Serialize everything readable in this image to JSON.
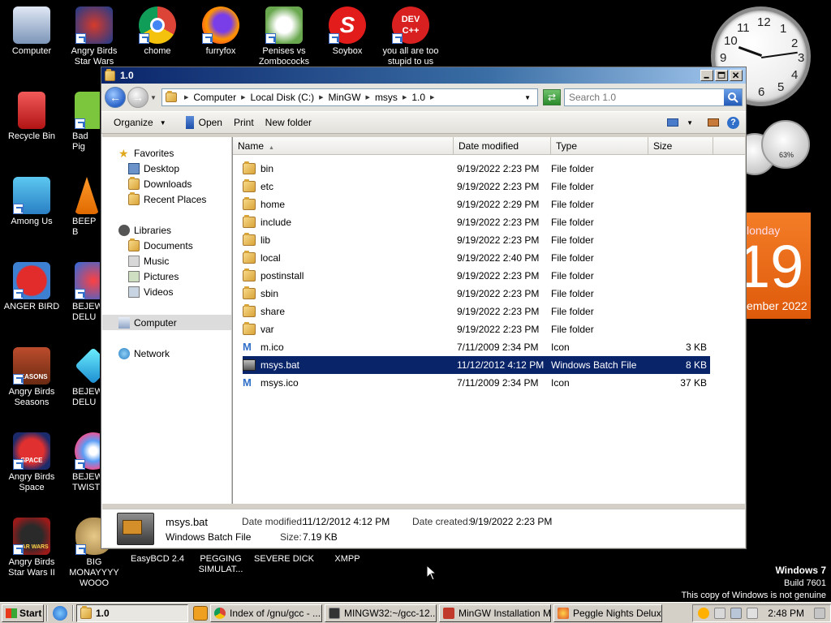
{
  "desktop": {
    "icons": [
      {
        "label": "Computer"
      },
      {
        "label": "Angry Birds Star Wars"
      },
      {
        "label": "chome"
      },
      {
        "label": "furryfox"
      },
      {
        "label": "Penises vs Zombococks"
      },
      {
        "label": "Soybox"
      },
      {
        "label": "you all are too stupid to us"
      },
      {
        "label": "Recycle Bin"
      },
      {
        "label": "Bad Pig"
      },
      {
        "label": "Among Us"
      },
      {
        "label": "BEEP B"
      },
      {
        "label": "ANGER BIRD"
      },
      {
        "label": "BEJEW DELU"
      },
      {
        "label": "Angry Birds Seasons"
      },
      {
        "label": "BEJEW DELU"
      },
      {
        "label": "Angry Birds Space"
      },
      {
        "label": "BEJEW TWIST"
      },
      {
        "label": "Angry Birds Star Wars II"
      },
      {
        "label": "BIG MONAYYYY WOOO"
      },
      {
        "label": "EasyBCD 2.4"
      },
      {
        "label": "PEGGING SIMULAT..."
      },
      {
        "label": "SEVERE DICK"
      },
      {
        "label": "XMPP"
      }
    ],
    "icon_badges": {
      "soybox": "S",
      "dev": "DEV C++",
      "bird_seasons": "SEASONS",
      "bird_space": "SPACE",
      "bird_starwars": "STAR WARS"
    },
    "calendar": {
      "weekday": "londay",
      "day": "19",
      "month": "ember 2022"
    },
    "meter_text": "63%",
    "clock_numbers": [
      "12",
      "1",
      "2",
      "3",
      "4",
      "5",
      "6",
      "7",
      "8",
      "9",
      "10",
      "11"
    ],
    "watermark": {
      "line1": "Windows 7",
      "line2": "Build 7601",
      "line3": "This copy of Windows is not genuine"
    }
  },
  "window": {
    "title": "1.0",
    "address": {
      "segments": [
        "Computer",
        "Local Disk (C:)",
        "MinGW",
        "msys",
        "1.0"
      ]
    },
    "search_placeholder": "Search 1.0",
    "toolbar": {
      "organize": "Organize",
      "open": "Open",
      "print": "Print",
      "new_folder": "New folder"
    },
    "nav": {
      "favorites": "Favorites",
      "desktop": "Desktop",
      "downloads": "Downloads",
      "recent": "Recent Places",
      "libraries": "Libraries",
      "documents": "Documents",
      "music": "Music",
      "pictures": "Pictures",
      "videos": "Videos",
      "computer": "Computer",
      "network": "Network"
    },
    "columns": {
      "name": "Name",
      "date": "Date modified",
      "type": "Type",
      "size": "Size"
    },
    "files": [
      {
        "name": "bin",
        "date": "9/19/2022 2:23 PM",
        "type": "File folder",
        "size": ""
      },
      {
        "name": "etc",
        "date": "9/19/2022 2:23 PM",
        "type": "File folder",
        "size": ""
      },
      {
        "name": "home",
        "date": "9/19/2022 2:29 PM",
        "type": "File folder",
        "size": ""
      },
      {
        "name": "include",
        "date": "9/19/2022 2:23 PM",
        "type": "File folder",
        "size": ""
      },
      {
        "name": "lib",
        "date": "9/19/2022 2:23 PM",
        "type": "File folder",
        "size": ""
      },
      {
        "name": "local",
        "date": "9/19/2022 2:40 PM",
        "type": "File folder",
        "size": ""
      },
      {
        "name": "postinstall",
        "date": "9/19/2022 2:23 PM",
        "type": "File folder",
        "size": ""
      },
      {
        "name": "sbin",
        "date": "9/19/2022 2:23 PM",
        "type": "File folder",
        "size": ""
      },
      {
        "name": "share",
        "date": "9/19/2022 2:23 PM",
        "type": "File folder",
        "size": ""
      },
      {
        "name": "var",
        "date": "9/19/2022 2:23 PM",
        "type": "File folder",
        "size": ""
      },
      {
        "name": "m.ico",
        "date": "7/11/2009 2:34 PM",
        "type": "Icon",
        "size": "3 KB"
      },
      {
        "name": "msys.bat",
        "date": "11/12/2012 4:12 PM",
        "type": "Windows Batch File",
        "size": "8 KB"
      },
      {
        "name": "msys.ico",
        "date": "7/11/2009 2:34 PM",
        "type": "Icon",
        "size": "37 KB"
      }
    ],
    "details": {
      "filename": "msys.bat",
      "filetype": "Windows Batch File",
      "modified_label": "Date modified:",
      "modified": "11/12/2012 4:12 PM",
      "created_label": "Date created:",
      "created": "9/19/2022 2:23 PM",
      "size_label": "Size:",
      "size": "7.19 KB"
    }
  },
  "taskbar": {
    "start": "Start",
    "buttons": [
      {
        "label": "1.0"
      },
      {
        "label": "Index of /gnu/gcc - ..."
      },
      {
        "label": "MINGW32:~/gcc-12...."
      },
      {
        "label": "MinGW Installation M..."
      },
      {
        "label": "Peggle Nights Delux..."
      }
    ],
    "time": "2:48 PM"
  },
  "colors": {
    "titlebar": "#0a246a",
    "selection": "#0a246a",
    "calendar": "#f47d28"
  }
}
